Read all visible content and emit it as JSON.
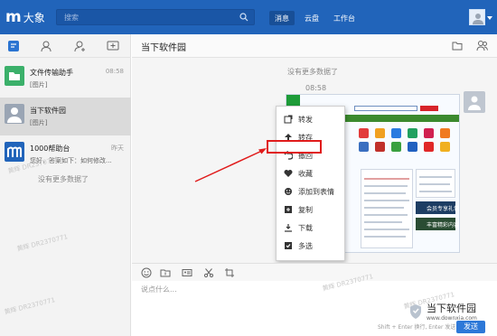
{
  "app": {
    "logo_mark": "m",
    "logo_text": "大象"
  },
  "topbar": {
    "search_placeholder": "搜索",
    "tabs": [
      {
        "label": "消息"
      },
      {
        "label": "云盘"
      },
      {
        "label": "工作台"
      }
    ]
  },
  "sidebar": {
    "conversations": [
      {
        "name": "文件传输助手",
        "preview": "[图片]",
        "time": "08:58",
        "icon": "folder-icon",
        "color": "#3bb06a"
      },
      {
        "name": "当下软件园",
        "preview": "[图片]",
        "time": "",
        "icon": "user-avatar-icon",
        "color": "#9aa5b4"
      },
      {
        "name": "1000帮助台",
        "preview": "您好，答案如下：如何修改...",
        "time": "昨天",
        "icon": "m-logo-icon",
        "color": "#2164ba"
      }
    ],
    "no_more": "没有更多数据了"
  },
  "chat": {
    "title": "当下软件园",
    "no_more": "没有更多数据了",
    "time": "08:58",
    "input_placeholder": "说点什么...",
    "shortcut_hint": "Shift + Enter 换行, Enter 发送",
    "send_label": "发送"
  },
  "context_menu": {
    "items": [
      {
        "label": "转发",
        "icon": "forward-icon"
      },
      {
        "label": "转存",
        "icon": "save-icon"
      },
      {
        "label": "撤回",
        "icon": "recall-icon"
      },
      {
        "label": "收藏",
        "icon": "heart-icon"
      },
      {
        "label": "添加到表情",
        "icon": "smile-icon"
      },
      {
        "label": "复制",
        "icon": "copy-icon"
      },
      {
        "label": "下载",
        "icon": "download-icon"
      },
      {
        "label": "多选",
        "icon": "checkbox-icon"
      }
    ],
    "highlight_color": "#e01b1b"
  },
  "screenshot_ads": [
    "会员专享礼包",
    "丰富精彩内容"
  ],
  "watermarks": [
    "黄辉 DR2370771"
  ],
  "brand": {
    "name": "当下软件园",
    "url": "www.downxia.com"
  }
}
